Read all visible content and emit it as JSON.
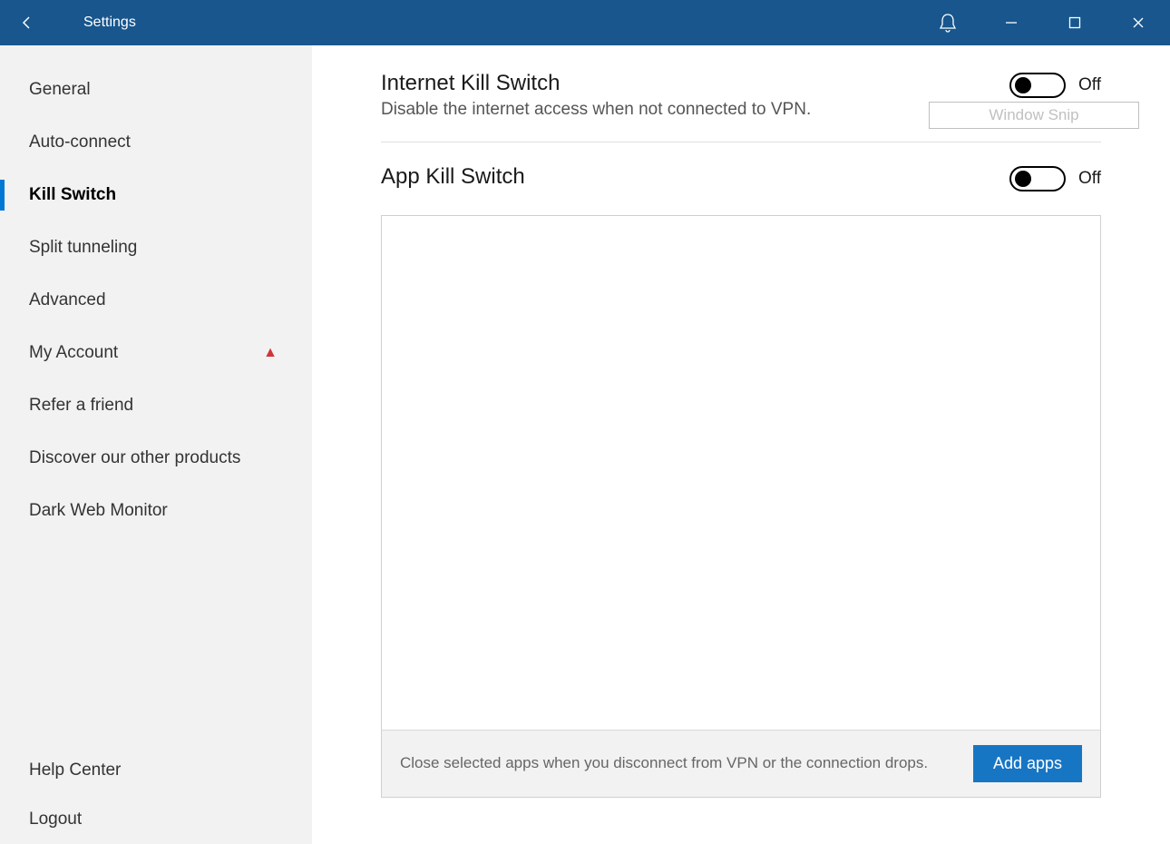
{
  "titlebar": {
    "title": "Settings"
  },
  "sidebar": {
    "items": [
      {
        "label": "General",
        "active": false,
        "warn": false
      },
      {
        "label": "Auto-connect",
        "active": false,
        "warn": false
      },
      {
        "label": "Kill Switch",
        "active": true,
        "warn": false
      },
      {
        "label": "Split tunneling",
        "active": false,
        "warn": false
      },
      {
        "label": "Advanced",
        "active": false,
        "warn": false
      },
      {
        "label": "My Account",
        "active": false,
        "warn": true
      },
      {
        "label": "Refer a friend",
        "active": false,
        "warn": false
      },
      {
        "label": "Discover our other products",
        "active": false,
        "warn": false
      },
      {
        "label": "Dark Web Monitor",
        "active": false,
        "warn": false
      }
    ],
    "bottom": [
      {
        "label": "Help Center"
      },
      {
        "label": "Logout"
      }
    ]
  },
  "main": {
    "internet_kill": {
      "title": "Internet Kill Switch",
      "desc": "Disable the internet access when not connected to VPN.",
      "state_label": "Off"
    },
    "app_kill": {
      "title": "App Kill Switch",
      "state_label": "Off",
      "hint": "Close selected apps when you disconnect from VPN or the connection drops.",
      "add_label": "Add apps"
    }
  },
  "overlay": {
    "snip_label": "Window Snip"
  }
}
